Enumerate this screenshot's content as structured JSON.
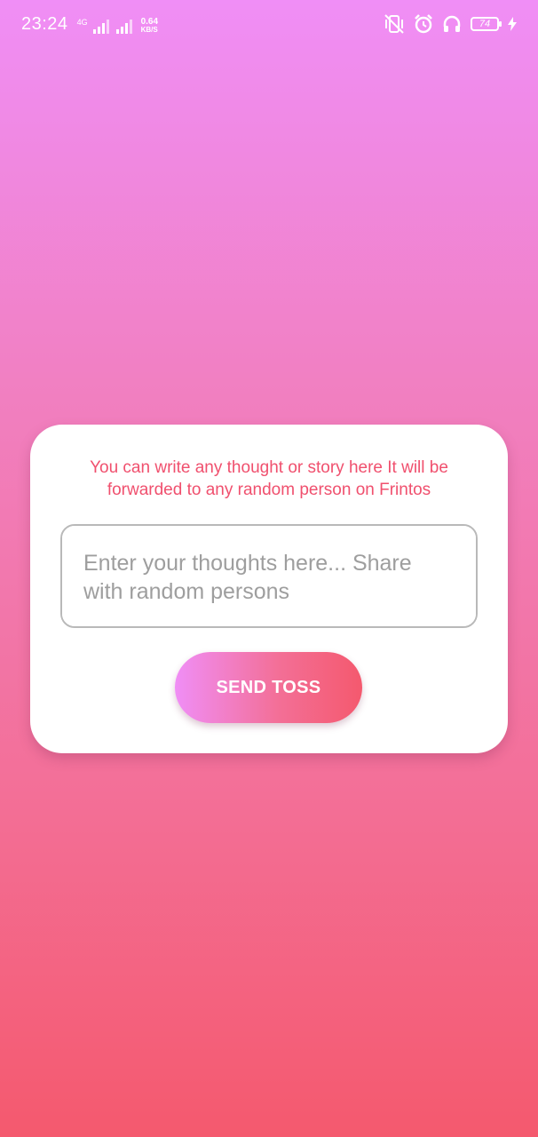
{
  "status_bar": {
    "time": "23:24",
    "network_label": "4G",
    "speed_value": "0.64",
    "speed_unit": "KB/S",
    "battery_level": "74",
    "icons": [
      "signal-icon",
      "signal-icon",
      "vibrate-icon",
      "alarm-icon",
      "headphones-icon",
      "battery-icon",
      "charging-icon"
    ],
    "text_color": "#ffffff"
  },
  "colors": {
    "background_top": "#f08ef6",
    "background_bottom": "#f4596e",
    "accent": "#f0506e"
  },
  "toss_card": {
    "info_text": "You can write any thought or story here It will be forwarded to any random person on Frintos",
    "input_value": "",
    "input_placeholder": "Enter your thoughts here... Share with random persons",
    "send_button_label": "SEND TOSS"
  }
}
